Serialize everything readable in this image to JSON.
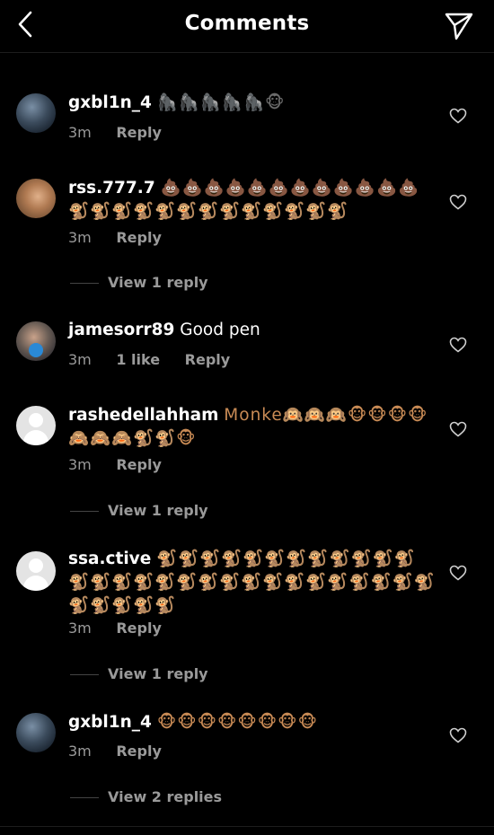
{
  "header": {
    "title": "Comments"
  },
  "comments": [
    {
      "username": "gxbl1n_4",
      "text": "🦍🦍🦍🦍🦍🐵",
      "time": "3m",
      "likes": "",
      "reply": "Reply",
      "view_replies": ""
    },
    {
      "username": "rss.777.7",
      "text": "💩💩💩💩💩💩💩💩💩💩💩💩🐒🐒🐒🐒🐒🐒🐒🐒🐒🐒🐒🐒🐒",
      "time": "3m",
      "likes": "",
      "reply": "Reply",
      "view_replies": "View 1 reply"
    },
    {
      "username": "jamesorr89",
      "text": "Good pen",
      "time": "3m",
      "likes": "1 like",
      "reply": "Reply",
      "view_replies": ""
    },
    {
      "username": "rashedellahham",
      "text": "Monke🙉🙉🙉🐵🐵🐵🐵🙈🙈🙈🐒🐒🐵",
      "time": "3m",
      "likes": "",
      "reply": "Reply",
      "view_replies": "View 1 reply"
    },
    {
      "username": "ssa.ctive",
      "text": "🐒🐒🐒🐒🐒🐒🐒🐒🐒🐒🐒🐒🐒🐒🐒🐒🐒🐒🐒🐒🐒🐒🐒🐒🐒🐒🐒🐒🐒🐒🐒🐒🐒🐒",
      "time": "3m",
      "likes": "",
      "reply": "Reply",
      "view_replies": "View 1 reply"
    },
    {
      "username": "gxbl1n_4",
      "text": "🐵🐵🐵🐵🐵🐵🐵🐵",
      "time": "3m",
      "likes": "",
      "reply": "Reply",
      "view_replies": "View 2 replies"
    }
  ],
  "icons": {
    "back": "chevron-left-icon",
    "send": "send-icon",
    "like": "heart-icon"
  }
}
